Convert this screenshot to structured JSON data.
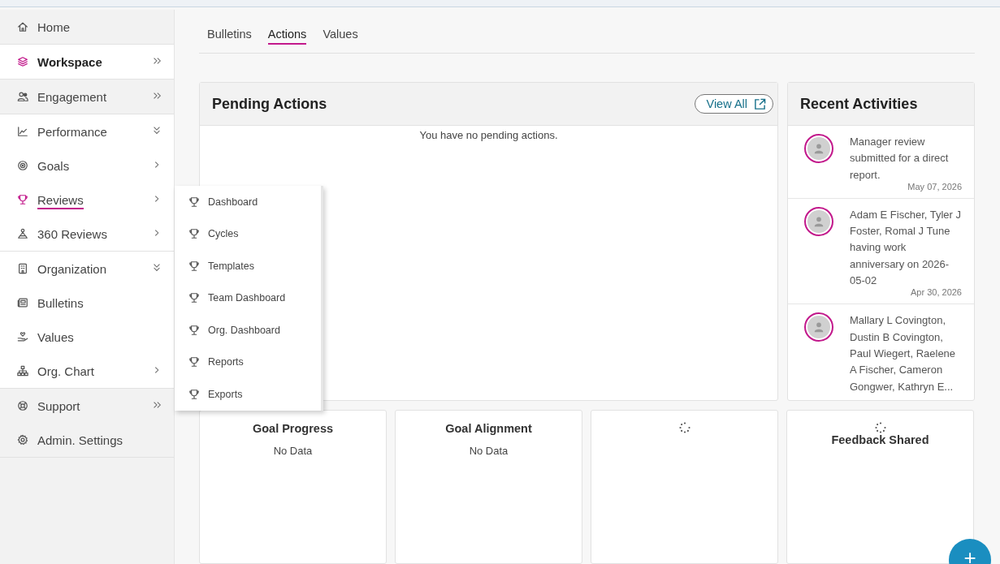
{
  "sidebar": {
    "groups": [
      {
        "shaded": true,
        "items": [
          {
            "label": "Home",
            "kind": "link",
            "selected": false,
            "submenu_open": false
          }
        ]
      },
      {
        "shaded": false,
        "items": [
          {
            "label": "Workspace",
            "kind": "section",
            "selected": true,
            "submenu_open": false
          }
        ]
      },
      {
        "shaded": true,
        "items": [
          {
            "label": "Engagement",
            "kind": "section",
            "selected": false,
            "submenu_open": false
          }
        ]
      },
      {
        "shaded": false,
        "items": [
          {
            "label": "Performance",
            "kind": "group",
            "selected": false,
            "submenu_open": false
          },
          {
            "label": "Goals",
            "kind": "submenu",
            "selected": false,
            "submenu_open": false
          },
          {
            "label": "Reviews",
            "kind": "submenu",
            "selected": false,
            "submenu_open": true
          },
          {
            "label": "360 Reviews",
            "kind": "submenu",
            "selected": false,
            "submenu_open": false
          }
        ]
      },
      {
        "shaded": false,
        "items": [
          {
            "label": "Organization",
            "kind": "group",
            "selected": false,
            "submenu_open": false
          },
          {
            "label": "Bulletins",
            "kind": "link",
            "selected": false,
            "submenu_open": false
          },
          {
            "label": "Values",
            "kind": "link",
            "selected": false,
            "submenu_open": false
          },
          {
            "label": "Org. Chart",
            "kind": "submenu",
            "selected": false,
            "submenu_open": false
          }
        ]
      },
      {
        "shaded": true,
        "items": [
          {
            "label": "Support",
            "kind": "section",
            "selected": false,
            "submenu_open": false
          },
          {
            "label": "Admin. Settings",
            "kind": "link",
            "selected": false,
            "submenu_open": false
          }
        ]
      }
    ]
  },
  "submenu": {
    "items": [
      "Dashboard",
      "Cycles",
      "Templates",
      "Team Dashboard",
      "Org. Dashboard",
      "Reports",
      "Exports"
    ]
  },
  "tabs": [
    {
      "label": "Bulletins",
      "selected": false
    },
    {
      "label": "Actions",
      "selected": true
    },
    {
      "label": "Values",
      "selected": false
    }
  ],
  "pending_actions": {
    "title": "Pending Actions",
    "view_all": "View All",
    "empty_message": "You have no pending actions."
  },
  "recent_activities": {
    "title": "Recent Activities",
    "items": [
      {
        "text": "Manager review submitted for a direct report.",
        "date": "May 07, 2026"
      },
      {
        "text": "Adam E Fischer, Tyler J Foster, Romal J Tune having work anniversary on 2026-05-02",
        "date": "Apr 30, 2026"
      },
      {
        "text": "Mallary L Covington, Dustin B Covington, Paul Wiegert, Raelene A Fischer, Cameron Gongwer, Kathryn E..."
      }
    ]
  },
  "widgets": [
    {
      "title": "Goal Progress",
      "note": "No Data",
      "loading": false
    },
    {
      "title": "Goal Alignment",
      "note": "No Data",
      "loading": false
    },
    {
      "loading": true
    },
    {
      "title": "Feedback Shared",
      "loading": true
    }
  ],
  "fab": {
    "label": "+"
  }
}
